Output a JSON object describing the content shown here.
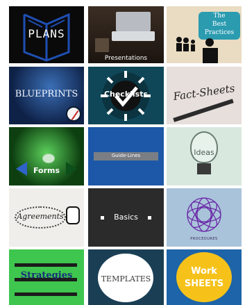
{
  "tiles": [
    {
      "label": "PLANS"
    },
    {
      "label": "Presentations"
    },
    {
      "label_line1": "The",
      "label_line2": "Best",
      "label_line3": "Practices"
    },
    {
      "label": "BLUEPRINTS"
    },
    {
      "label": "Checklists"
    },
    {
      "label": "Fact-Sheets"
    },
    {
      "label": "Forms"
    },
    {
      "label": "Guide-Lines"
    },
    {
      "label": "Ideas"
    },
    {
      "label": "Agreements"
    },
    {
      "label": "Basics"
    },
    {
      "label": "PROCEDURES"
    },
    {
      "label": "Strategies"
    },
    {
      "label": "TEMPLATES"
    },
    {
      "label_line1": "Work",
      "label_line2": "SHEETS"
    }
  ],
  "colors": {
    "plans_blue": "#1f4fb3",
    "chalk_white": "#ffffff",
    "teal_ribbon": "#2b9bb0",
    "forms_blue": "#2f63c9",
    "guideline_gray": "#7a7e84",
    "strategies_green": "#3ec64f",
    "worksheets_yellow": "#f6c21a"
  }
}
